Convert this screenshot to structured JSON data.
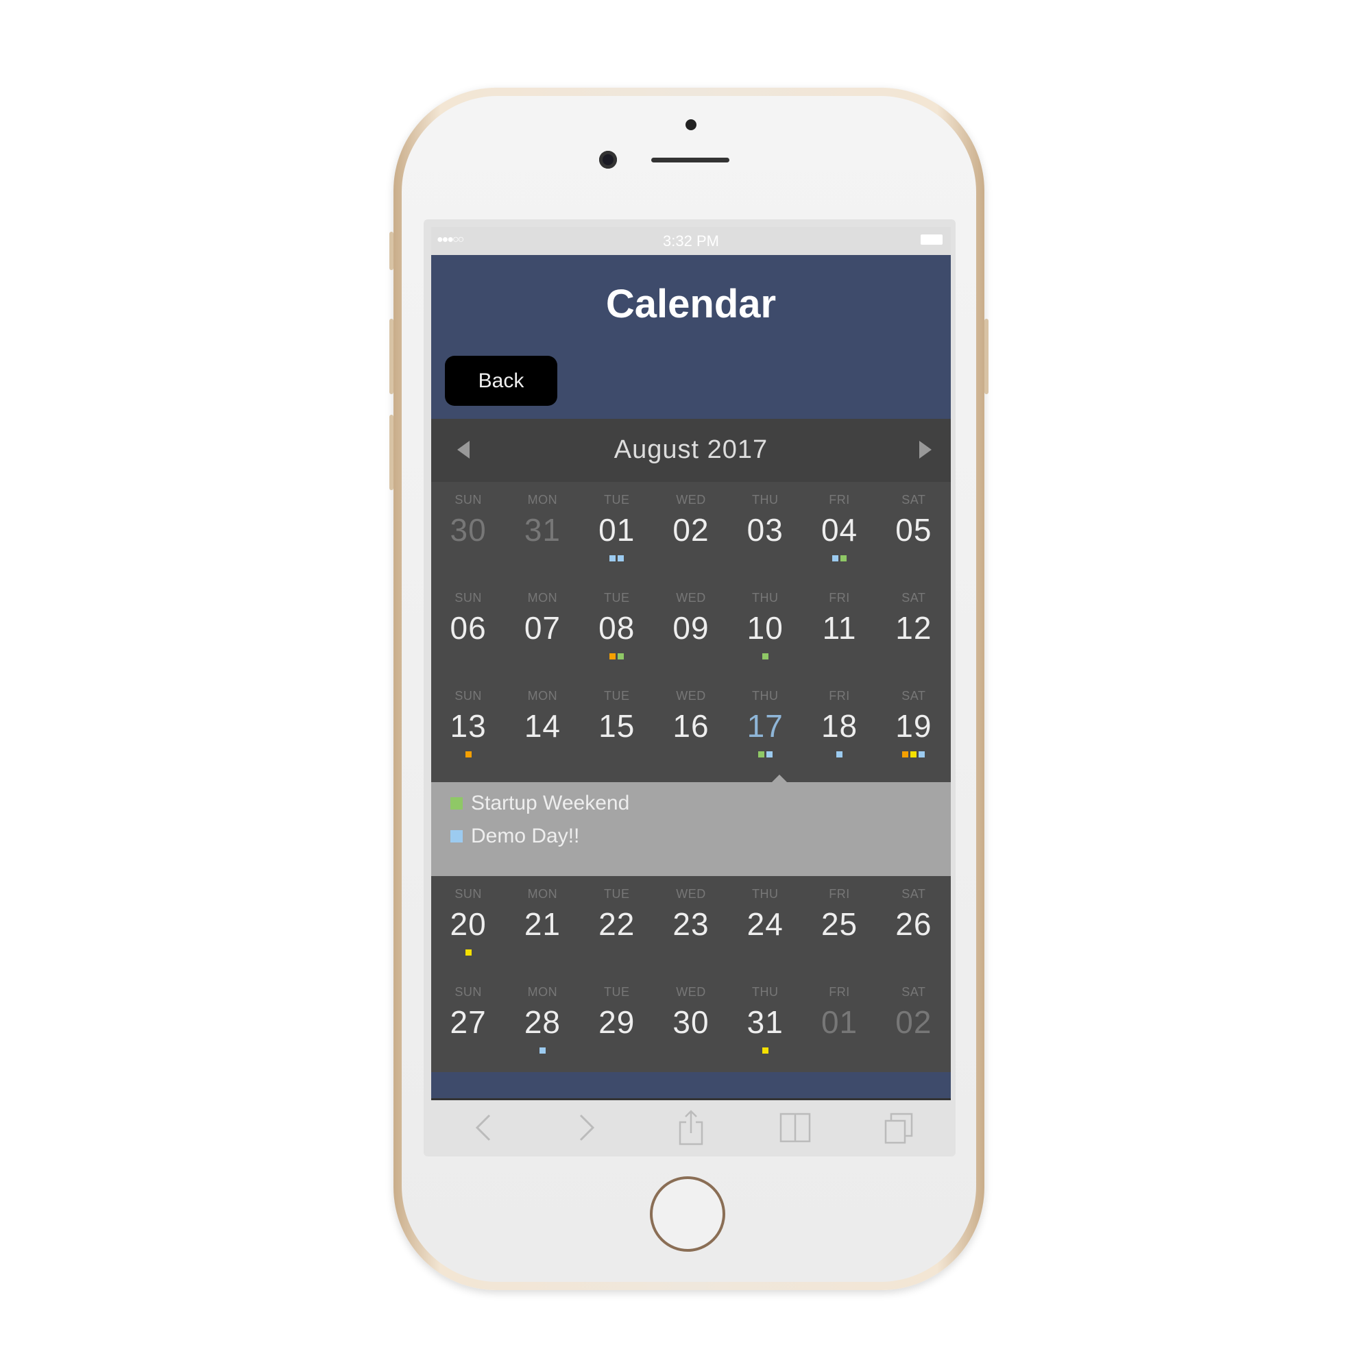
{
  "status_bar": {
    "signal": "●●●○○",
    "time": "3:32 PM"
  },
  "header": {
    "title": "Calendar",
    "back_label": "Back"
  },
  "calendar": {
    "month_label": "August 2017",
    "selected_day": "17",
    "rows": [
      [
        {
          "dow": "SUN",
          "day": "30",
          "other": true,
          "dots": []
        },
        {
          "dow": "MON",
          "day": "31",
          "other": true,
          "dots": []
        },
        {
          "dow": "TUE",
          "day": "01",
          "dots": [
            "#9ccbf0",
            "#9ccbf0"
          ]
        },
        {
          "dow": "WED",
          "day": "02",
          "dots": []
        },
        {
          "dow": "THU",
          "day": "03",
          "dots": []
        },
        {
          "dow": "FRI",
          "day": "04",
          "dots": [
            "#9ccbf0",
            "#8fc866"
          ]
        },
        {
          "dow": "SAT",
          "day": "05",
          "dots": []
        }
      ],
      [
        {
          "dow": "SUN",
          "day": "06",
          "dots": []
        },
        {
          "dow": "MON",
          "day": "07",
          "dots": []
        },
        {
          "dow": "TUE",
          "day": "08",
          "dots": [
            "#f5a000",
            "#8fc866"
          ]
        },
        {
          "dow": "WED",
          "day": "09",
          "dots": []
        },
        {
          "dow": "THU",
          "day": "10",
          "dots": [
            "#8fc866"
          ]
        },
        {
          "dow": "FRI",
          "day": "11",
          "dots": []
        },
        {
          "dow": "SAT",
          "day": "12",
          "dots": []
        }
      ],
      [
        {
          "dow": "SUN",
          "day": "13",
          "dots": [
            "#f5a000"
          ]
        },
        {
          "dow": "MON",
          "day": "14",
          "dots": []
        },
        {
          "dow": "TUE",
          "day": "15",
          "dots": []
        },
        {
          "dow": "WED",
          "day": "16",
          "dots": []
        },
        {
          "dow": "THU",
          "day": "17",
          "selected": true,
          "dots": [
            "#8fc866",
            "#9ccbf0"
          ]
        },
        {
          "dow": "FRI",
          "day": "18",
          "dots": [
            "#9ccbf0"
          ]
        },
        {
          "dow": "SAT",
          "day": "19",
          "dots": [
            "#f5a000",
            "#f5e000",
            "#9ccbf0"
          ]
        }
      ],
      [
        {
          "dow": "SUN",
          "day": "20",
          "dots": [
            "#f5e000"
          ]
        },
        {
          "dow": "MON",
          "day": "21",
          "dots": []
        },
        {
          "dow": "TUE",
          "day": "22",
          "dots": []
        },
        {
          "dow": "WED",
          "day": "23",
          "dots": []
        },
        {
          "dow": "THU",
          "day": "24",
          "dots": []
        },
        {
          "dow": "FRI",
          "day": "25",
          "dots": []
        },
        {
          "dow": "SAT",
          "day": "26",
          "dots": []
        }
      ],
      [
        {
          "dow": "SUN",
          "day": "27",
          "dots": []
        },
        {
          "dow": "MON",
          "day": "28",
          "dots": [
            "#9ccbf0"
          ]
        },
        {
          "dow": "TUE",
          "day": "29",
          "dots": []
        },
        {
          "dow": "WED",
          "day": "30",
          "dots": []
        },
        {
          "dow": "THU",
          "day": "31",
          "dots": [
            "#f5e000"
          ]
        },
        {
          "dow": "FRI",
          "day": "01",
          "other": true,
          "dots": []
        },
        {
          "dow": "SAT",
          "day": "02",
          "other": true,
          "dots": []
        }
      ]
    ],
    "events": [
      {
        "title": "Startup Weekend",
        "color": "#8fc866"
      },
      {
        "title": "Demo Day!!",
        "color": "#9ccbf0"
      }
    ]
  },
  "colors": {
    "header": "#3e4b6b",
    "grid": "#4a4a4a",
    "popup": "#a5a5a5",
    "selected": "#8fb6d8"
  },
  "browser_toolbar": {
    "icons": [
      "back-icon",
      "forward-icon",
      "share-icon",
      "bookmarks-icon",
      "tabs-icon"
    ]
  }
}
